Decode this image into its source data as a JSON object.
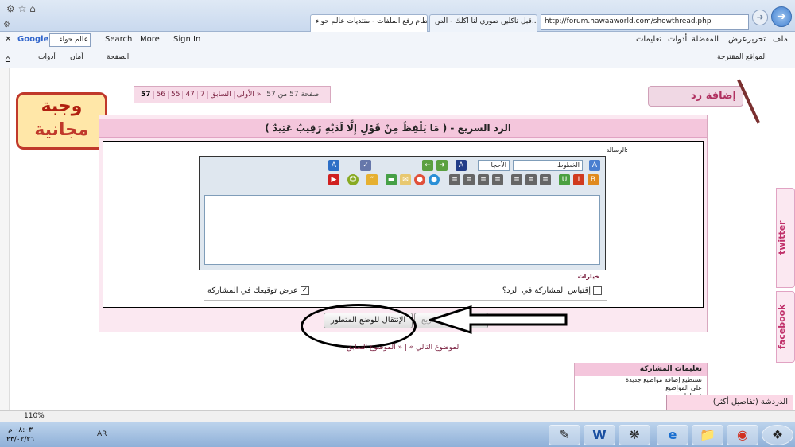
{
  "browser": {
    "tabs": [
      "نظام رفع الملفات - منتديات عالم حواء",
      "قبل تاكلين صوري لنا اكلك - الص...",
      "x"
    ],
    "address": "http://forum.hawaaworld.com/showthread.php",
    "menu": [
      "ملف",
      "تحرير",
      "عرض",
      "المفضلة",
      "أدوات",
      "تعليمات"
    ],
    "favorites_label": "المواقع المقترحة",
    "search_label": "Search",
    "more_label": "More",
    "signin_label": "Sign In",
    "google_label": "Google",
    "search_box": "عالم حواء",
    "cmd_items": [
      "الصفحة",
      "أمان",
      "أدوات"
    ]
  },
  "pager": {
    "label": "صفحة 57 من 57",
    "first": "« الأولى",
    "prev": "السابق",
    "pages": [
      "7",
      "47",
      "55",
      "56",
      "57"
    ],
    "current": "57"
  },
  "logo": {
    "line1": "وجبة",
    "line2": "مجانية"
  },
  "add_reply": "إضافة رد",
  "quick_reply": {
    "title": "الرد السريع - ( مَا يَلْفِظُ مِنْ قَوْلٍ إِلَّا لَدَيْهِ رَقِيبٌ عَتِيدٌ )",
    "message_label": "الرسالة:",
    "font_select": "الخطوط",
    "size_select": "الأحجا",
    "options_label": "خيارات",
    "opt_quote": "إقتباس المشاركة في الرد؟",
    "opt_signature": "عرض توقيعك في المشاركة",
    "btn_advanced": "الإنتقال للوضع المتطور",
    "btn_reply": "إضافة الرد السريع"
  },
  "thread_nav": {
    "prev": "« الموضوع السابق",
    "next": "الموضوع التالي »"
  },
  "rules": {
    "title": "تعليمات المشاركة",
    "lines": [
      "تستطيع إضافة مواضيع جديدة",
      "على المواضيع",
      "ق ملفات"
    ]
  },
  "chat": "الدردشة (تفاصيل أكثر)",
  "social": {
    "twitter": "twitter",
    "facebook": "facebook"
  },
  "status": {
    "zoom": "110%"
  },
  "taskbar": {
    "time": "٠٨:٠٣ م",
    "date": "٢٣/٠٢/٢٦",
    "lang": "AR"
  }
}
